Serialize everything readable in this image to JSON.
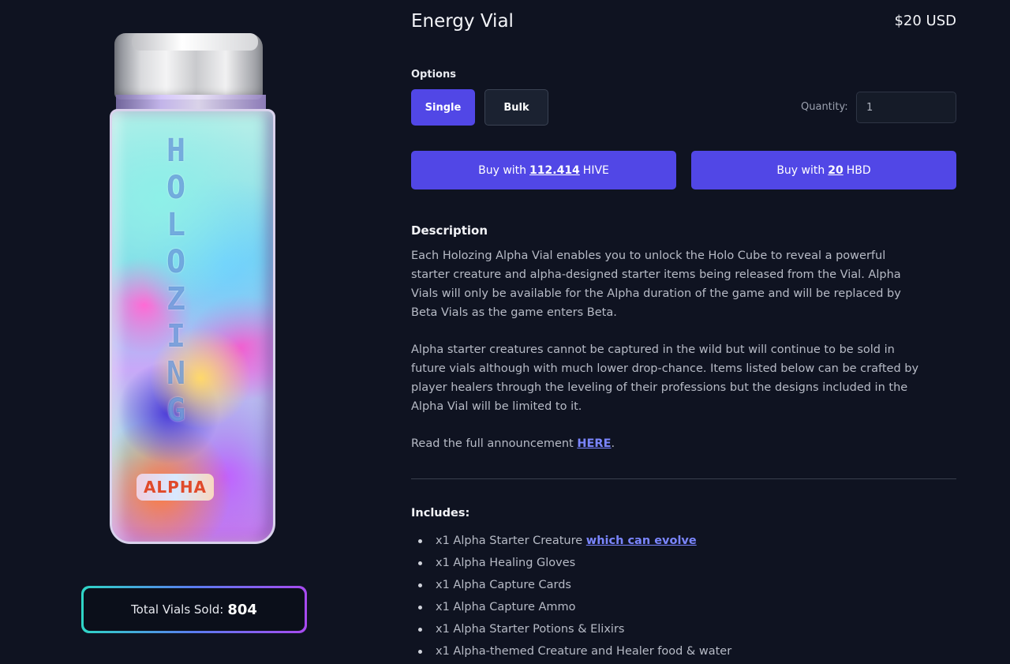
{
  "product": {
    "title": "Energy Vial",
    "price": "$20 USD",
    "vial_letters": [
      "H",
      "O",
      "L",
      "O",
      "Z",
      "I",
      "N",
      "G"
    ],
    "vial_badge": "ALPHA"
  },
  "stats": {
    "total_sold_label": "Total Vials Sold:",
    "total_sold_value": "804"
  },
  "options": {
    "label": "Options",
    "items": [
      "Single",
      "Bulk"
    ],
    "selected": "Single"
  },
  "quantity": {
    "label": "Quantity:",
    "value": "1"
  },
  "buy": {
    "hive": {
      "prefix": "Buy with",
      "amount": "112.414",
      "currency": "HIVE"
    },
    "hbd": {
      "prefix": "Buy with",
      "amount": "20",
      "currency": "HBD"
    }
  },
  "description": {
    "heading": "Description",
    "p1": "Each Holozing Alpha Vial enables you to unlock the Holo Cube to reveal a powerful starter creature and alpha-designed starter items being released from the Vial. Alpha Vials will only be available for the Alpha duration of the game and will be replaced by Beta Vials as the game enters Beta.",
    "p2": "Alpha starter creatures cannot be captured in the wild but will continue to be sold in future vials although with much lower drop-chance. Items listed below can be crafted by player healers through the leveling of their professions but the designs included in the Alpha Vial will be limited to it.",
    "p3_prefix": "Read the full announcement",
    "p3_link": "HERE",
    "p3_suffix": "."
  },
  "includes": {
    "heading": "Includes:",
    "items": [
      {
        "text": "x1 Alpha Starter Creature",
        "link": "which can evolve"
      },
      {
        "text": "x1 Alpha Healing Gloves"
      },
      {
        "text": "x1 Alpha Capture Cards"
      },
      {
        "text": "x1 Alpha Capture Ammo"
      },
      {
        "text": "x1 Alpha Starter Potions & Elixirs"
      },
      {
        "text": "x1 Alpha-themed Creature and Healer food & water"
      }
    ]
  },
  "colors": {
    "background": "#0f1321",
    "accent": "#5147e6",
    "link": "#7b86ff"
  }
}
